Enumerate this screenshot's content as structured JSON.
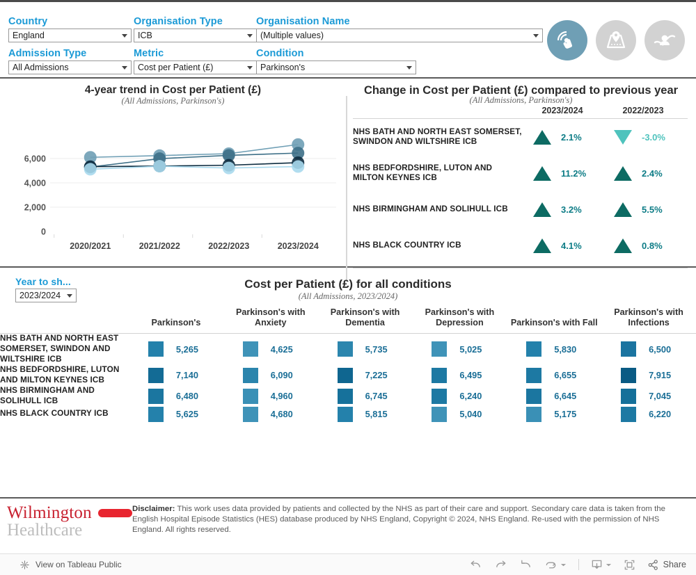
{
  "filters": {
    "country": {
      "label": "Country",
      "value": "England"
    },
    "org_type": {
      "label": "Organisation Type",
      "value": "ICB"
    },
    "org_name": {
      "label": "Organisation Name",
      "value": "(Multiple values)"
    },
    "admission_type": {
      "label": "Admission Type",
      "value": "All Admissions"
    },
    "metric": {
      "label": "Metric",
      "value": "Cost per Patient (£)"
    },
    "condition": {
      "label": "Condition",
      "value": "Parkinson's"
    }
  },
  "nav_icons": [
    {
      "name": "click-interaction-icon",
      "state": "active"
    },
    {
      "name": "map-pin-icon",
      "state": "inactive"
    },
    {
      "name": "care-hands-icon",
      "state": "inactive"
    }
  ],
  "trend": {
    "title": "4-year trend in Cost per Patient (£)",
    "subtitle": "(All Admissions, Parkinson's)"
  },
  "change": {
    "title": "Change in Cost per Patient (£) compared to previous year",
    "subtitle": "(All Admissions, Parkinson's)",
    "columns": [
      "",
      "2023/2024",
      "2022/2023"
    ],
    "rows": [
      {
        "org": "NHS BATH AND NORTH EAST SOMERSET, SWINDON AND WILTSHIRE ICB",
        "v1": "2.1%",
        "d1": "up",
        "v2": "-3.0%",
        "d2": "down"
      },
      {
        "org": "NHS BEDFORDSHIRE, LUTON AND MILTON KEYNES ICB",
        "v1": "11.2%",
        "d1": "up",
        "v2": "2.4%",
        "d2": "up"
      },
      {
        "org": "NHS BIRMINGHAM AND SOLIHULL ICB",
        "v1": "3.2%",
        "d1": "up",
        "v2": "5.5%",
        "d2": "up"
      },
      {
        "org": "NHS BLACK COUNTRY ICB",
        "v1": "4.1%",
        "d1": "up",
        "v2": "0.8%",
        "d2": "up"
      }
    ]
  },
  "year_filter": {
    "label": "Year to sh...",
    "value": "2023/2024"
  },
  "bottom": {
    "title": "Cost per Patient (£) for all conditions",
    "subtitle": "(All Admissions, 2023/2024)",
    "columns": [
      "",
      "Parkinson's",
      "Parkinson's with Anxiety",
      "Parkinson's with Dementia",
      "Parkinson's with Depression",
      "Parkinson's with Fall",
      "Parkinson's with Infections"
    ],
    "rows": [
      {
        "org": "NHS BATH AND NORTH EAST SOMERSET, SWINDON AND WILTSHIRE ICB",
        "values": [
          "5,265",
          "4,625",
          "5,735",
          "5,025",
          "5,830",
          "6,500"
        ],
        "colors": [
          "#2481ab",
          "#3f93b8",
          "#2c86ae",
          "#3f93b8",
          "#2481ab",
          "#1b74a0"
        ]
      },
      {
        "org": "NHS BEDFORDSHIRE, LUTON AND MILTON KEYNES ICB",
        "values": [
          "7,140",
          "6,090",
          "7,225",
          "6,495",
          "6,655",
          "7,915"
        ],
        "colors": [
          "#136b95",
          "#2b85ad",
          "#0f6690",
          "#1d79a3",
          "#1d79a3",
          "#0a5b84"
        ]
      },
      {
        "org": "NHS BIRMINGHAM AND SOLIHULL ICB",
        "values": [
          "6,480",
          "4,960",
          "6,745",
          "6,240",
          "6,645",
          "7,045"
        ],
        "colors": [
          "#1b76a0",
          "#3a90b6",
          "#16719b",
          "#1d79a3",
          "#1b76a0",
          "#15709a"
        ]
      },
      {
        "org": "NHS BLACK COUNTRY ICB",
        "values": [
          "5,625",
          "4,680",
          "5,815",
          "5,040",
          "5,175",
          "6,220"
        ],
        "colors": [
          "#2481ab",
          "#3f93b8",
          "#2481ab",
          "#3f93b8",
          "#3a90b6",
          "#1d79a3"
        ]
      }
    ]
  },
  "footer": {
    "logo_primary": "Wilmington",
    "logo_secondary": "Healthcare",
    "disclaimer_label": "Disclaimer:",
    "disclaimer_text": " This work uses data provided by patients and collected by the NHS as part of their care and support. Secondary care data is taken from the English Hospital Episode Statistics (HES) database produced by NHS England, Copyright © 2024, NHS England. Re-used with the permission of NHS England. All rights reserved."
  },
  "toolbar": {
    "view_label": "View on Tableau Public",
    "share_label": "Share"
  },
  "chart_data": {
    "type": "line",
    "title": "4-year trend in Cost per Patient (£)",
    "subtitle": "(All Admissions, Parkinson's)",
    "xlabel": "",
    "ylabel": "",
    "categories": [
      "2020/2021",
      "2021/2022",
      "2022/2023",
      "2023/2024"
    ],
    "ylim": [
      0,
      8000
    ],
    "yticks": [
      0,
      2000,
      4000,
      6000
    ],
    "ytick_labels": [
      "0",
      "2,000",
      "4,000",
      "6,000"
    ],
    "grid": true,
    "legend": "none",
    "series": [
      {
        "name": "NHS BATH AND NORTH EAST SOMERSET, SWINDON AND WILTSHIRE ICB",
        "color": "#6f9fb5",
        "values": [
          6100,
          6240,
          6400,
          7150
        ]
      },
      {
        "name": "NHS BEDFORDSHIRE, LUTON AND MILTON KEYNES ICB",
        "color": "#3d6f87",
        "values": [
          5300,
          5990,
          6260,
          6450
        ]
      },
      {
        "name": "NHS BIRMINGHAM AND SOLIHULL ICB",
        "color": "#0d2c40",
        "values": [
          5330,
          5380,
          5450,
          5660
        ]
      },
      {
        "name": "NHS BLACK COUNTRY ICB",
        "color": "#a8d9ed",
        "values": [
          5120,
          5370,
          5220,
          5340
        ]
      }
    ]
  }
}
